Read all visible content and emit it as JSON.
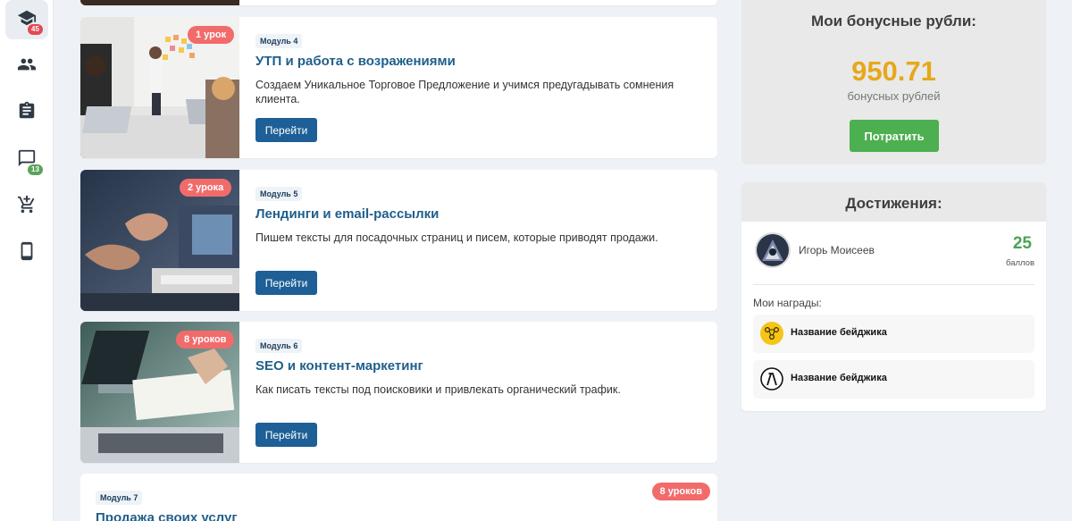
{
  "sidebar": {
    "items": [
      {
        "icon": "graduation-cap-icon",
        "badge": "45",
        "badge_color": "#e54850",
        "active": true
      },
      {
        "icon": "group-icon"
      },
      {
        "icon": "clipboard-icon"
      },
      {
        "icon": "chat-icon",
        "badge": "13",
        "badge_color": "#5aa35a"
      },
      {
        "icon": "add-to-cart-icon"
      },
      {
        "icon": "smartphone-icon"
      }
    ]
  },
  "modules": [
    {
      "lessons": "1 урок",
      "module": "Модуль 4",
      "title": "УТП и работа с возражениями",
      "description": "Создаем Уникальное Торговое Предложение и учимся предугадывать сомнения клиента.",
      "button": "Перейти"
    },
    {
      "lessons": "2 урока",
      "module": "Модуль 5",
      "title": "Лендинги и email-рассылки",
      "description": "Пишем тексты для посадочных страниц и писем, которые приводят продажи.",
      "button": "Перейти"
    },
    {
      "lessons": "8 уроков",
      "module": "Модуль 6",
      "title": "SEO и контент-маркетинг",
      "description": "Как писать тексты под поисковики и привлекать органический трафик.",
      "button": "Перейти"
    }
  ],
  "module7": {
    "module": "Модуль 7",
    "title": "Продажа своих услуг",
    "lessons": "8 уроков"
  },
  "bonus": {
    "heading": "Мои бонусные рубли:",
    "amount": "950.71",
    "unit": "бонусных рублей",
    "button": "Потратить"
  },
  "achievements": {
    "heading": "Достижения:",
    "user_name": "Игорь Моисеев",
    "score": "25",
    "score_unit": "баллов",
    "awards_label": "Мои награды:",
    "badges": [
      {
        "name": "Название бейджика",
        "icon": "network-badge-icon"
      },
      {
        "name": "Название бейджика",
        "icon": "lambda-badge-icon"
      }
    ]
  },
  "colors": {
    "accent_blue": "#1d5f96",
    "title_blue": "#1f5f8b",
    "pill_red": "#f26b6b",
    "bonus_gold": "#e6a81a",
    "success_green": "#4caf50",
    "score_green": "#4aa356"
  }
}
